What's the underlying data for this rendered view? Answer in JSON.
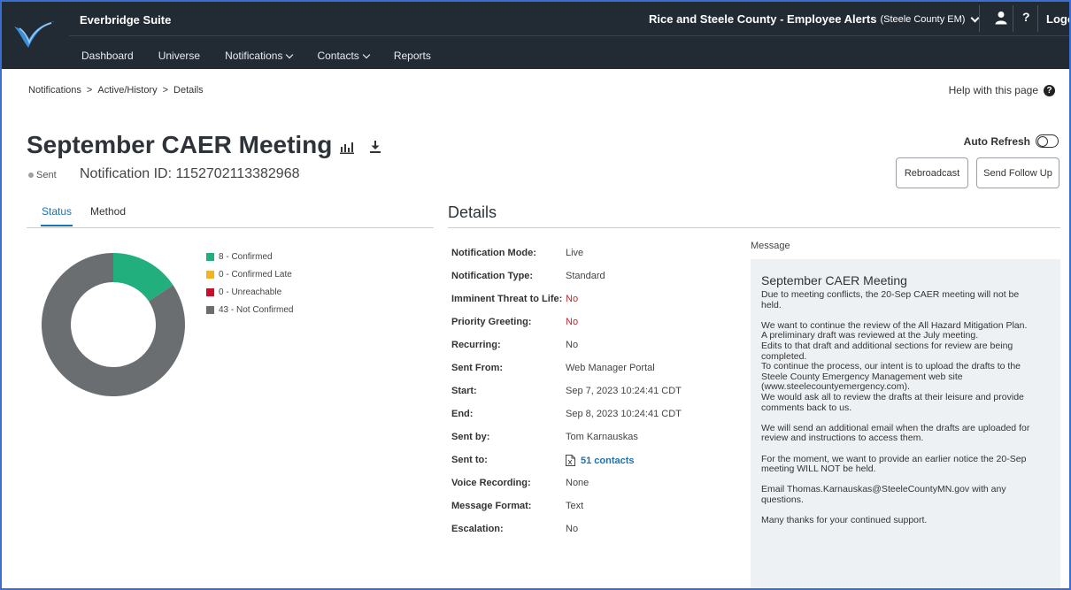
{
  "header": {
    "suite_title": "Everbridge Suite",
    "org_name": "Rice and Steele County - Employee Alerts",
    "org_sub": "(Steele County EM)",
    "help_glyph": "?",
    "logout": "Logout"
  },
  "nav": {
    "items": [
      {
        "label": "Dashboard"
      },
      {
        "label": "Universe"
      },
      {
        "label": "Notifications"
      },
      {
        "label": "Contacts"
      },
      {
        "label": "Reports"
      }
    ]
  },
  "breadcrumb": {
    "items": [
      "Notifications",
      "Active/History",
      "Details"
    ],
    "separator": ">"
  },
  "help_page": "Help with this page",
  "page": {
    "title": "September CAER Meeting",
    "status": "Sent",
    "notification_id": "Notification ID: 1152702113382968",
    "auto_refresh": "Auto Refresh",
    "rebroadcast": "Rebroadcast",
    "send_follow_up": "Send Follow Up"
  },
  "tabs": [
    {
      "label": "Status"
    },
    {
      "label": "Method"
    }
  ],
  "chart_data": {
    "type": "pie",
    "style": "donut",
    "categories": [
      "Confirmed",
      "Confirmed Late",
      "Unreachable",
      "Not Confirmed"
    ],
    "values": [
      8,
      0,
      0,
      43
    ],
    "colors": [
      "#21b07d",
      "#f0b429",
      "#c8102e",
      "#6b6e70"
    ],
    "legend_labels": [
      "8 - Confirmed",
      "0 - Confirmed Late",
      "0 - Unreachable",
      "43 - Not Confirmed"
    ],
    "legend_position": "right"
  },
  "details": {
    "title": "Details",
    "rows": [
      {
        "label": "Notification Mode:",
        "value": "Live"
      },
      {
        "label": "Notification Type:",
        "value": "Standard"
      },
      {
        "label": "Imminent Threat to Life:",
        "value": "No"
      },
      {
        "label": "Priority Greeting:",
        "value": "No"
      },
      {
        "label": "Recurring:",
        "value": "No"
      },
      {
        "label": "Sent From:",
        "value": "Web Manager Portal"
      },
      {
        "label": "Start:",
        "value": "Sep 7, 2023 10:24:41 CDT"
      },
      {
        "label": "End:",
        "value": "Sep 8, 2023 10:24:41 CDT"
      },
      {
        "label": "Sent by:",
        "value": "Tom Karnauskas"
      },
      {
        "label": "Sent to:",
        "value": "51  contacts"
      },
      {
        "label": "Voice Recording:",
        "value": "None"
      },
      {
        "label": "Message Format:",
        "value": "Text"
      },
      {
        "label": "Escalation:",
        "value": "No"
      }
    ]
  },
  "message": {
    "label": "Message",
    "title": "September CAER Meeting",
    "lines": [
      "Due to meeting conflicts, the 20-Sep CAER meeting will not be",
      "held.",
      "",
      "We want to continue the review of the All Hazard Mitigation Plan.",
      "A preliminary draft was reviewed at the July meeting.",
      "Edits to that draft and additional sections for review are being",
      "completed.",
      "To continue the process, our intent is to upload the drafts to the",
      "Steele County Emergency Management web site",
      "(www.steelecountyemergency.com).",
      "We would ask all to review the drafts at their leisure and provide",
      "comments back to us.",
      "",
      "We will send an additional email when the drafts are uploaded for",
      "review and instructions to access them.",
      "",
      "For the moment, we want to provide an earlier notice the 20-Sep",
      "meeting WILL NOT be held.",
      "",
      "Email Thomas.Karnauskas@SteeleCountyMN.gov with any",
      "questions.",
      "",
      "Many thanks for your continued support."
    ]
  },
  "icons": {
    "logo": "everbridge-logo",
    "user": "user-icon",
    "help": "help-icon",
    "bar_chart": "bar-chart-icon",
    "download": "download-icon",
    "spreadsheet": "spreadsheet-icon"
  }
}
